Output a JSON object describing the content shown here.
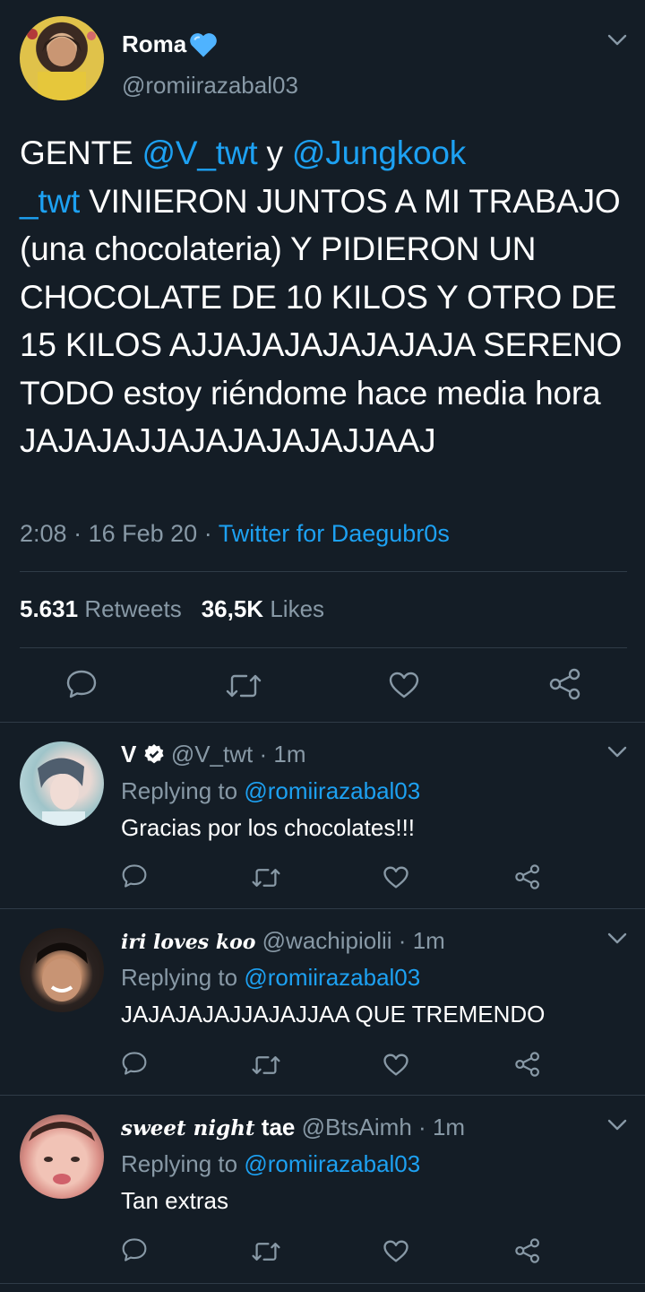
{
  "main_tweet": {
    "display_name": "Roma",
    "name_emoji": "blue-heart",
    "handle": "@romiirazabal03",
    "text_parts": {
      "t1": "GENTE ",
      "m1": "@V_twt",
      "t2": " y ",
      "m2": "@Jungkook",
      "m2b": "_twt",
      "t3": " VINIERON JUNTOS A MI TRABAJO (una chocolateria) Y PIDIERON UN CHOCOLATE DE 10 KILOS Y OTRO DE 15 KILOS AJJAJAJAJAJAJAJA SERENO TODO estoy riéndome hace media hora JAJAJAJJAJAJAJAJAJJAAJ"
    },
    "time": "2:08",
    "date": "16 Feb 20",
    "source": "Twitter for Daegubr0s",
    "retweets_count": "5.631",
    "retweets_label": "Retweets",
    "likes_count": "36,5K",
    "likes_label": "Likes"
  },
  "replies": [
    {
      "display_name": "V",
      "verified": true,
      "handle": "@V_twt",
      "time": "1m",
      "replying_label": "Replying to",
      "replying_to": "@romiirazabal03",
      "text": "Gracias por los chocolates!!!"
    },
    {
      "display_name": "iri loves koo",
      "handle": "@wachipiolii",
      "time": "1m",
      "replying_label": "Replying to",
      "replying_to": "@romiirazabal03",
      "text": "JAJAJAJAJJAJAJJAA QUE TREMENDO"
    },
    {
      "display_name_styled": "sweet night",
      "display_name_plain": "tae",
      "handle": "@BtsAimh",
      "time": "1m",
      "replying_label": "Replying to",
      "replying_to": "@romiirazabal03",
      "text": "Tan extras"
    }
  ],
  "separator": "·",
  "colors": {
    "background": "#141d26",
    "link": "#1da1f2",
    "secondary_text": "#8899a6",
    "divider": "#2f3b47"
  }
}
